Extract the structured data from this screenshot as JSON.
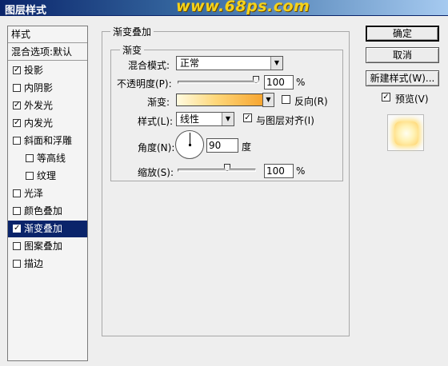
{
  "window": {
    "title": "图层样式",
    "watermark": "www.68ps.com"
  },
  "style_list": {
    "header": "样式",
    "blend_options": "混合选项:默认",
    "items": [
      {
        "label": "投影",
        "checked": true
      },
      {
        "label": "内阴影",
        "checked": false
      },
      {
        "label": "外发光",
        "checked": true
      },
      {
        "label": "内发光",
        "checked": true
      },
      {
        "label": "斜面和浮雕",
        "checked": false
      },
      {
        "label": "等高线",
        "checked": false
      },
      {
        "label": "纹理",
        "checked": false
      },
      {
        "label": "光泽",
        "checked": false
      },
      {
        "label": "颜色叠加",
        "checked": false
      },
      {
        "label": "渐变叠加",
        "checked": true,
        "selected": true
      },
      {
        "label": "图案叠加",
        "checked": false
      },
      {
        "label": "描边",
        "checked": false
      }
    ]
  },
  "gradient_overlay": {
    "group_title": "渐变叠加",
    "subgroup_title": "渐变",
    "blend_mode_label": "混合模式:",
    "blend_mode_value": "正常",
    "opacity_label": "不透明度(P):",
    "opacity_value": "100",
    "opacity_unit": "%",
    "gradient_label": "渐变:",
    "reverse_label": "反向(R)",
    "reverse_checked": false,
    "style_label": "样式(L):",
    "style_value": "线性",
    "align_label": "与图层对齐(I)",
    "align_checked": true,
    "angle_label": "角度(N):",
    "angle_value": "90",
    "angle_unit": "度",
    "scale_label": "缩放(S):",
    "scale_value": "100",
    "scale_unit": "%"
  },
  "buttons": {
    "ok": "确定",
    "cancel": "取消",
    "new_style": "新建样式(W)...",
    "preview_label": "预览(V)",
    "preview_checked": true
  },
  "check_mark": "✓",
  "dropdown_arrow": "▼"
}
